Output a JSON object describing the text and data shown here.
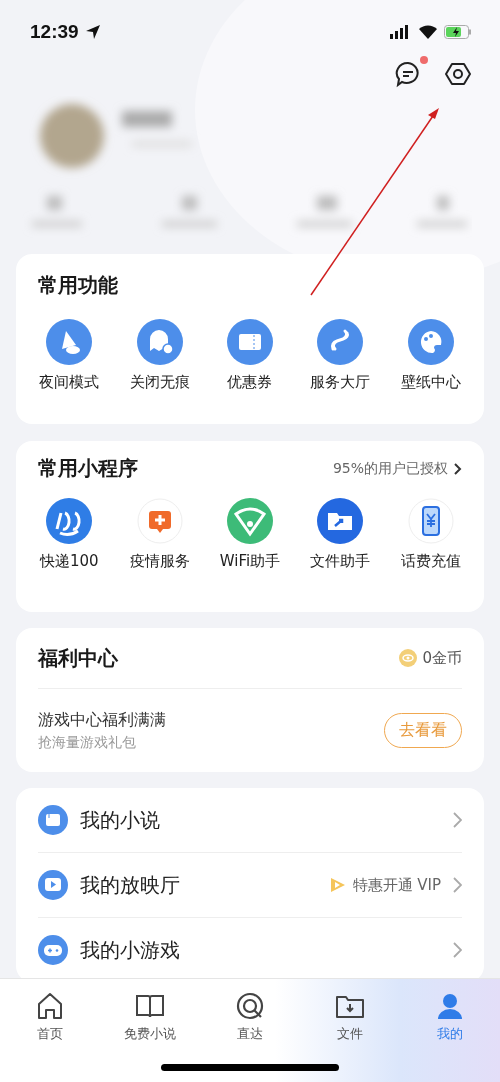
{
  "status_bar": {
    "time": "12:39"
  },
  "header": {
    "message_unread": true
  },
  "common_functions": {
    "title": "常用功能",
    "items": [
      {
        "label": "夜间模式",
        "kind": "night"
      },
      {
        "label": "关闭无痕",
        "kind": "ghost"
      },
      {
        "label": "优惠券",
        "kind": "ticket"
      },
      {
        "label": "服务大厅",
        "kind": "link"
      },
      {
        "label": "壁纸中心",
        "kind": "palette"
      }
    ]
  },
  "mini_programs": {
    "title": "常用小程序",
    "authorized": "95%的用户已授权",
    "items": [
      {
        "label": "快递100",
        "kind": "express"
      },
      {
        "label": "疫情服务",
        "kind": "health"
      },
      {
        "label": "WiFi助手",
        "kind": "wifi"
      },
      {
        "label": "文件助手",
        "kind": "folder"
      },
      {
        "label": "话费充值",
        "kind": "phone"
      }
    ]
  },
  "welfare": {
    "title": "福利中心",
    "coins": "0金币",
    "promo_title": "游戏中心福利满满",
    "promo_subtitle": "抢海量游戏礼包",
    "button": "去看看"
  },
  "menu": [
    {
      "label": "我的小说",
      "kind": "book"
    },
    {
      "label": "我的放映厅",
      "kind": "video",
      "extra": "特惠开通 VIP"
    },
    {
      "label": "我的小游戏",
      "kind": "game"
    }
  ],
  "tab_bar": [
    {
      "label": "首页",
      "kind": "home",
      "selected": false
    },
    {
      "label": "免费小说",
      "kind": "book",
      "selected": false
    },
    {
      "label": "直达",
      "kind": "direct",
      "selected": false
    },
    {
      "label": "文件",
      "kind": "file",
      "selected": false
    },
    {
      "label": "我的",
      "kind": "me",
      "selected": true
    }
  ]
}
